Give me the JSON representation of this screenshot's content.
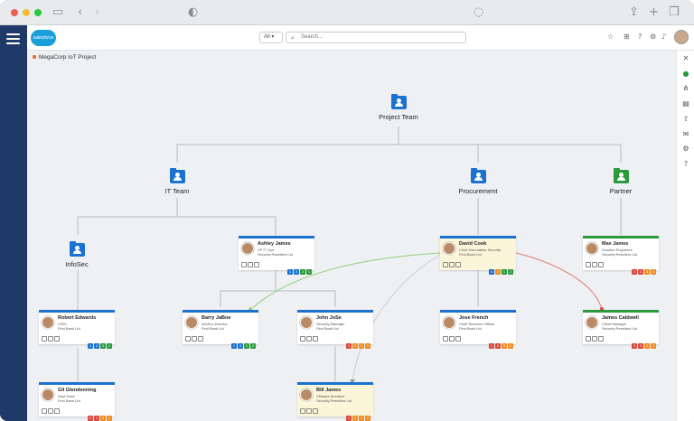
{
  "header": {
    "logo_text": "salesforce",
    "scope_label": "All",
    "search_placeholder": "Search..."
  },
  "breadcrumb": "MegaCorp IoT Project",
  "colors": {
    "accent": "#1a73d0",
    "partner": "#2a9a3c",
    "nav": "#1f3a68"
  },
  "groups": [
    {
      "id": "project-team",
      "label": "Project Team",
      "color": "#1a73d0"
    },
    {
      "id": "it-team",
      "label": "IT Team",
      "color": "#1a73d0"
    },
    {
      "id": "procurement",
      "label": "Procurement",
      "color": "#1a73d0"
    },
    {
      "id": "partner",
      "label": "Partner",
      "color": "#2a9a3c"
    },
    {
      "id": "infosec",
      "label": "InfoSec",
      "color": "#1a73d0"
    }
  ],
  "people": [
    {
      "name": "Ashley James",
      "title": "VP IT Ops",
      "org": "Security Resellers Ltd",
      "badges": [
        "1",
        "3",
        "2",
        "1"
      ]
    },
    {
      "name": "David Cook",
      "title": "Chief Information Security",
      "org": "First Bank Ltd",
      "badges": [
        "4",
        "2",
        "1",
        "2"
      ]
    },
    {
      "name": "Max James",
      "title": "Solution Engineers",
      "org": "Security Resellers Ltd",
      "badges": [
        "1",
        "2",
        "3",
        "3"
      ]
    },
    {
      "name": "Robert Edwards",
      "title": "CISO",
      "org": "First Bank Ltd",
      "badges": [
        "1",
        "2",
        "3",
        "1"
      ]
    },
    {
      "name": "Barry JaBoe",
      "title": "InfoSec Director",
      "org": "First Bank Ltd",
      "badges": [
        "1",
        "4",
        "2",
        "2"
      ]
    },
    {
      "name": "John JoSe",
      "title": "Security Manager",
      "org": "First Bank Ltd",
      "badges": [
        "1",
        "1",
        "2",
        "1"
      ]
    },
    {
      "name": "Jose French",
      "title": "Chief Revenue Officer",
      "org": "First Bank Ltd",
      "badges": [
        "1",
        "2",
        "3",
        "1"
      ]
    },
    {
      "name": "James Caldwell",
      "title": "Client Manager",
      "org": "Security Resellers Ltd",
      "badges": [
        "3",
        "3",
        "1",
        "1"
      ]
    },
    {
      "name": "Gil Glendenning",
      "title": "Dept Dave",
      "org": "First Bank Ltd",
      "badges": [
        "2",
        "1",
        "3",
        "1"
      ]
    },
    {
      "name": "Bill James",
      "title": "VMware Architect",
      "org": "Security Resellers Ltd",
      "badges": [
        "1",
        "3",
        "2",
        "2"
      ]
    }
  ]
}
